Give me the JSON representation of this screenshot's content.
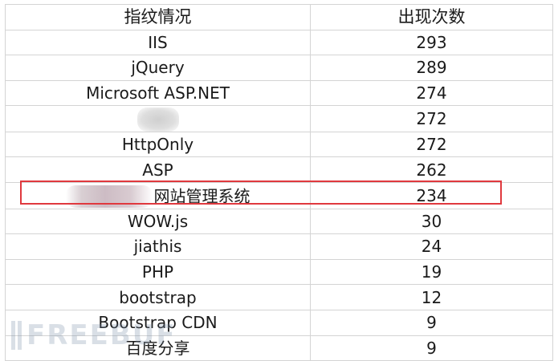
{
  "table": {
    "headers": [
      "指纹情况",
      "出现次数"
    ],
    "rows": [
      {
        "name": "IIS",
        "count": "293"
      },
      {
        "name": "jQuery",
        "count": "289"
      },
      {
        "name": "Microsoft ASP.NET",
        "count": "274"
      },
      {
        "name": "",
        "count": "272"
      },
      {
        "name": "HttpOnly",
        "count": "272"
      },
      {
        "name": "ASP",
        "count": "262"
      },
      {
        "name": "网站管理系统",
        "count": "234"
      },
      {
        "name": "WOW.js",
        "count": "30"
      },
      {
        "name": "jiathis",
        "count": "24"
      },
      {
        "name": "PHP",
        "count": "19"
      },
      {
        "name": "bootstrap",
        "count": "12"
      },
      {
        "name": "Bootstrap CDN",
        "count": "9"
      },
      {
        "name": "百度分享",
        "count": "9"
      }
    ]
  },
  "highlight": {
    "row_index": 6,
    "color": "#e0393e"
  },
  "watermark": {
    "text": "FREEBUF"
  }
}
